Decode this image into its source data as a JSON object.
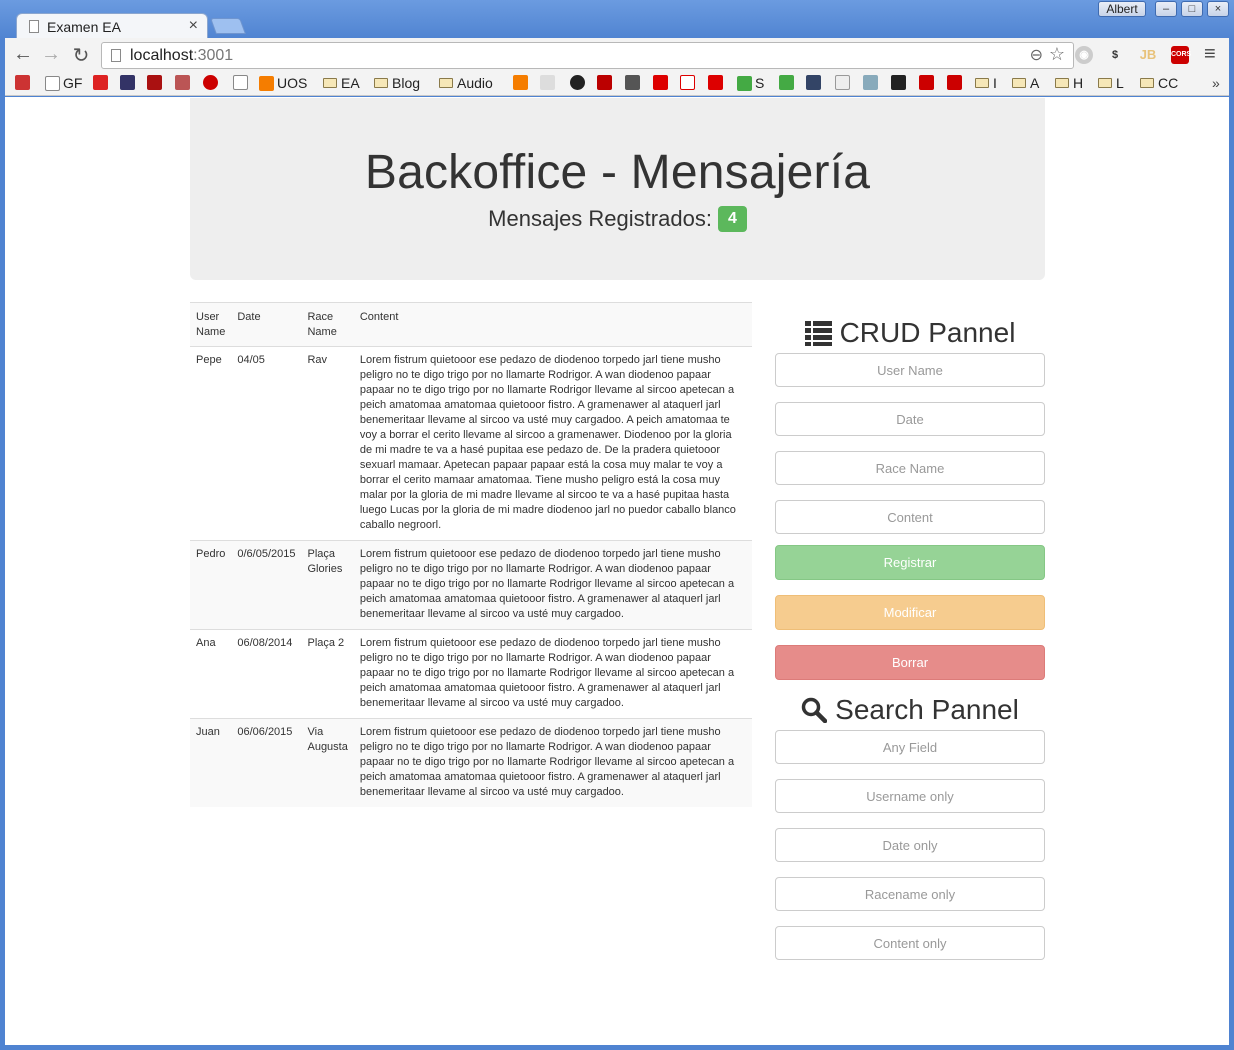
{
  "browser": {
    "tab_title": "Examen EA",
    "tab_close": "×",
    "profile_name": "Albert",
    "url_host": "localhost",
    "url_port": ":3001",
    "bookmarks": [
      {
        "label": "GF",
        "type": "page"
      },
      {
        "label": "UOS",
        "type": "blogger"
      },
      {
        "label": "EA",
        "type": "folder"
      },
      {
        "label": "Blog",
        "type": "folder"
      },
      {
        "label": "Audio",
        "type": "folder"
      },
      {
        "label": "S",
        "type": "app"
      },
      {
        "label": "I",
        "type": "folder"
      },
      {
        "label": "A",
        "type": "folder"
      },
      {
        "label": "H",
        "type": "folder"
      },
      {
        "label": "L",
        "type": "folder"
      },
      {
        "label": "CC",
        "type": "folder"
      }
    ],
    "bookmarks_overflow": "»",
    "extension_cors": "CORS"
  },
  "header": {
    "title": "Backoffice - Mensajería",
    "registered_label": "Mensajes Registrados:",
    "registered_count": "4"
  },
  "table": {
    "columns": [
      "User Name",
      "Date",
      "Race Name",
      "Content"
    ],
    "rows": [
      {
        "user": "Pepe",
        "date": "04/05",
        "race": "Rav",
        "content": "Lorem fistrum quietooor ese pedazo de diodenoo torpedo jarl tiene musho peligro no te digo trigo por no llamarte Rodrigor. A wan diodenoo papaar papaar no te digo trigo por no llamarte Rodrigor llevame al sircoo apetecan a peich amatomaa amatomaa quietooor fistro. A gramenawer al ataquerl jarl benemeritaar llevame al sircoo va usté muy cargadoo. A peich amatomaa te voy a borrar el cerito llevame al sircoo a gramenawer. Diodenoo por la gloria de mi madre te va a hasé pupitaa ese pedazo de. De la pradera quietooor sexuarl mamaar. Apetecan papaar papaar está la cosa muy malar te voy a borrar el cerito mamaar amatomaa. Tiene musho peligro está la cosa muy malar por la gloria de mi madre llevame al sircoo te va a hasé pupitaa hasta luego Lucas por la gloria de mi madre diodenoo jarl no puedor caballo blanco caballo negroorl."
      },
      {
        "user": "Pedro",
        "date": "0/6/05/2015",
        "race": "Plaça Glories",
        "content": "Lorem fistrum quietooor ese pedazo de diodenoo torpedo jarl tiene musho peligro no te digo trigo por no llamarte Rodrigor. A wan diodenoo papaar papaar no te digo trigo por no llamarte Rodrigor llevame al sircoo apetecan a peich amatomaa amatomaa quietooor fistro. A gramenawer al ataquerl jarl benemeritaar llevame al sircoo va usté muy cargadoo."
      },
      {
        "user": "Ana",
        "date": "06/08/2014",
        "race": "Plaça 2",
        "content": "Lorem fistrum quietooor ese pedazo de diodenoo torpedo jarl tiene musho peligro no te digo trigo por no llamarte Rodrigor. A wan diodenoo papaar papaar no te digo trigo por no llamarte Rodrigor llevame al sircoo apetecan a peich amatomaa amatomaa quietooor fistro. A gramenawer al ataquerl jarl benemeritaar llevame al sircoo va usté muy cargadoo."
      },
      {
        "user": "Juan",
        "date": "06/06/2015",
        "race": "Via Augusta",
        "content": "Lorem fistrum quietooor ese pedazo de diodenoo torpedo jarl tiene musho peligro no te digo trigo por no llamarte Rodrigor. A wan diodenoo papaar papaar no te digo trigo por no llamarte Rodrigor llevame al sircoo apetecan a peich amatomaa amatomaa quietooor fistro. A gramenawer al ataquerl jarl benemeritaar llevame al sircoo va usté muy cargadoo."
      }
    ]
  },
  "crud": {
    "title": "CRUD Pannel",
    "icon": "list-icon",
    "user_placeholder": "User Name",
    "date_placeholder": "Date",
    "race_placeholder": "Race Name",
    "content_placeholder": "Content",
    "register_label": "Registrar",
    "modify_label": "Modificar",
    "delete_label": "Borrar"
  },
  "search": {
    "title": "Search Pannel",
    "icon": "search-icon",
    "any_placeholder": "Any Field",
    "username_placeholder": "Username only",
    "date_placeholder": "Date only",
    "racename_placeholder": "Racename only",
    "content_placeholder": "Content only"
  },
  "colors": {
    "badge": "#5cb85c",
    "register": "#96d396",
    "modify": "#f6cc8f",
    "delete": "#e68c8a",
    "jumbotron": "#eeeeee"
  }
}
